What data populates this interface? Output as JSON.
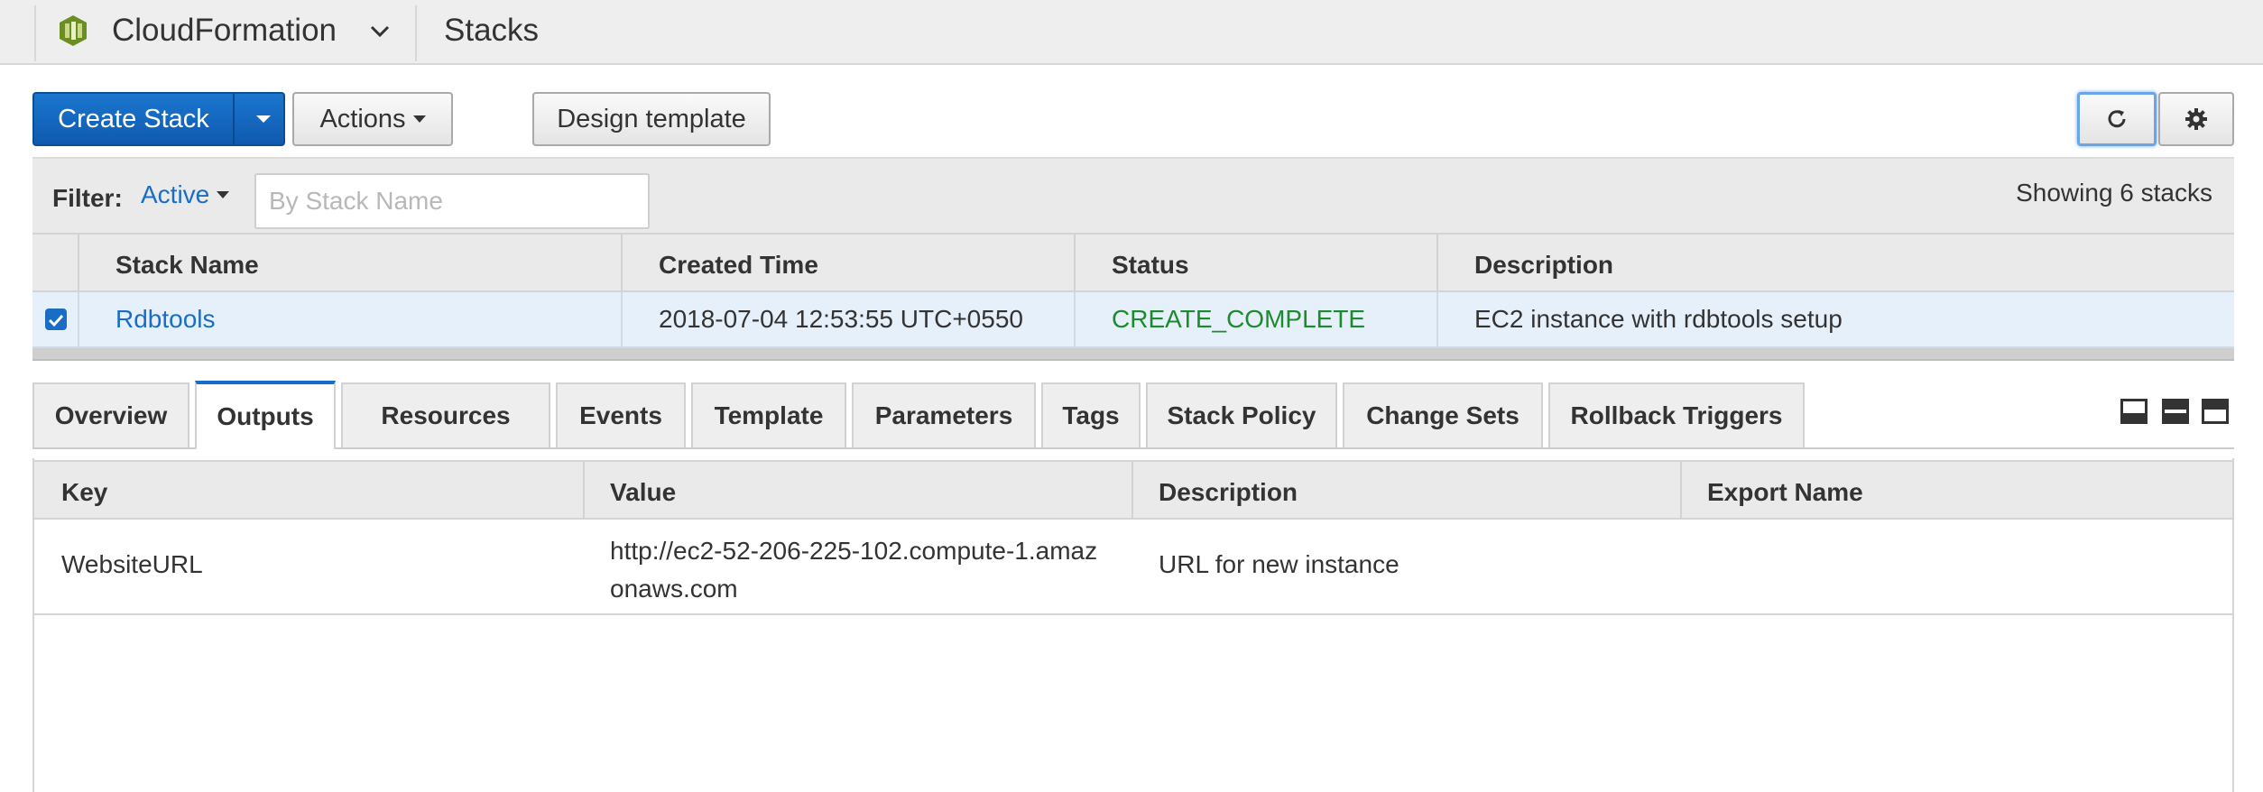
{
  "topbar": {
    "service_name": "CloudFormation",
    "page_title": "Stacks"
  },
  "toolbar": {
    "create_stack_label": "Create Stack",
    "actions_label": "Actions",
    "design_template_label": "Design template"
  },
  "filter": {
    "label": "Filter:",
    "active_label": "Active",
    "search_placeholder": "By Stack Name",
    "showing_text": "Showing 6 stacks"
  },
  "stacks_table": {
    "columns": [
      "Stack Name",
      "Created Time",
      "Status",
      "Description"
    ],
    "rows": [
      {
        "selected": true,
        "stack_name": "Rdbtools",
        "created_time": "2018-07-04 12:53:55 UTC+0550",
        "status": "CREATE_COMPLETE",
        "description": "EC2 instance with rdbtools setup"
      }
    ]
  },
  "detail_tabs": [
    {
      "label": "Overview",
      "active": false
    },
    {
      "label": "Outputs",
      "active": true
    },
    {
      "label": "Resources",
      "active": false
    },
    {
      "label": "Events",
      "active": false
    },
    {
      "label": "Template",
      "active": false
    },
    {
      "label": "Parameters",
      "active": false
    },
    {
      "label": "Tags",
      "active": false
    },
    {
      "label": "Stack Policy",
      "active": false
    },
    {
      "label": "Change Sets",
      "active": false
    },
    {
      "label": "Rollback Triggers",
      "active": false
    }
  ],
  "outputs_table": {
    "columns": [
      "Key",
      "Value",
      "Description",
      "Export Name"
    ],
    "rows": [
      {
        "key": "WebsiteURL",
        "value_line1": "http://ec2-52-206-225-102.compute-1.amaz",
        "value_line2": "onaws.com",
        "description": "URL for new instance",
        "export_name": ""
      }
    ]
  },
  "colors": {
    "primary_blue": "#1a6dc4",
    "status_green": "#1d8a2e",
    "selected_row": "#e6f0fb"
  },
  "icons": [
    "cloudformation-logo-icon",
    "chevron-down-icon",
    "refresh-icon",
    "gear-icon",
    "pane-bottom-icon",
    "pane-half-icon",
    "pane-top-icon"
  ]
}
